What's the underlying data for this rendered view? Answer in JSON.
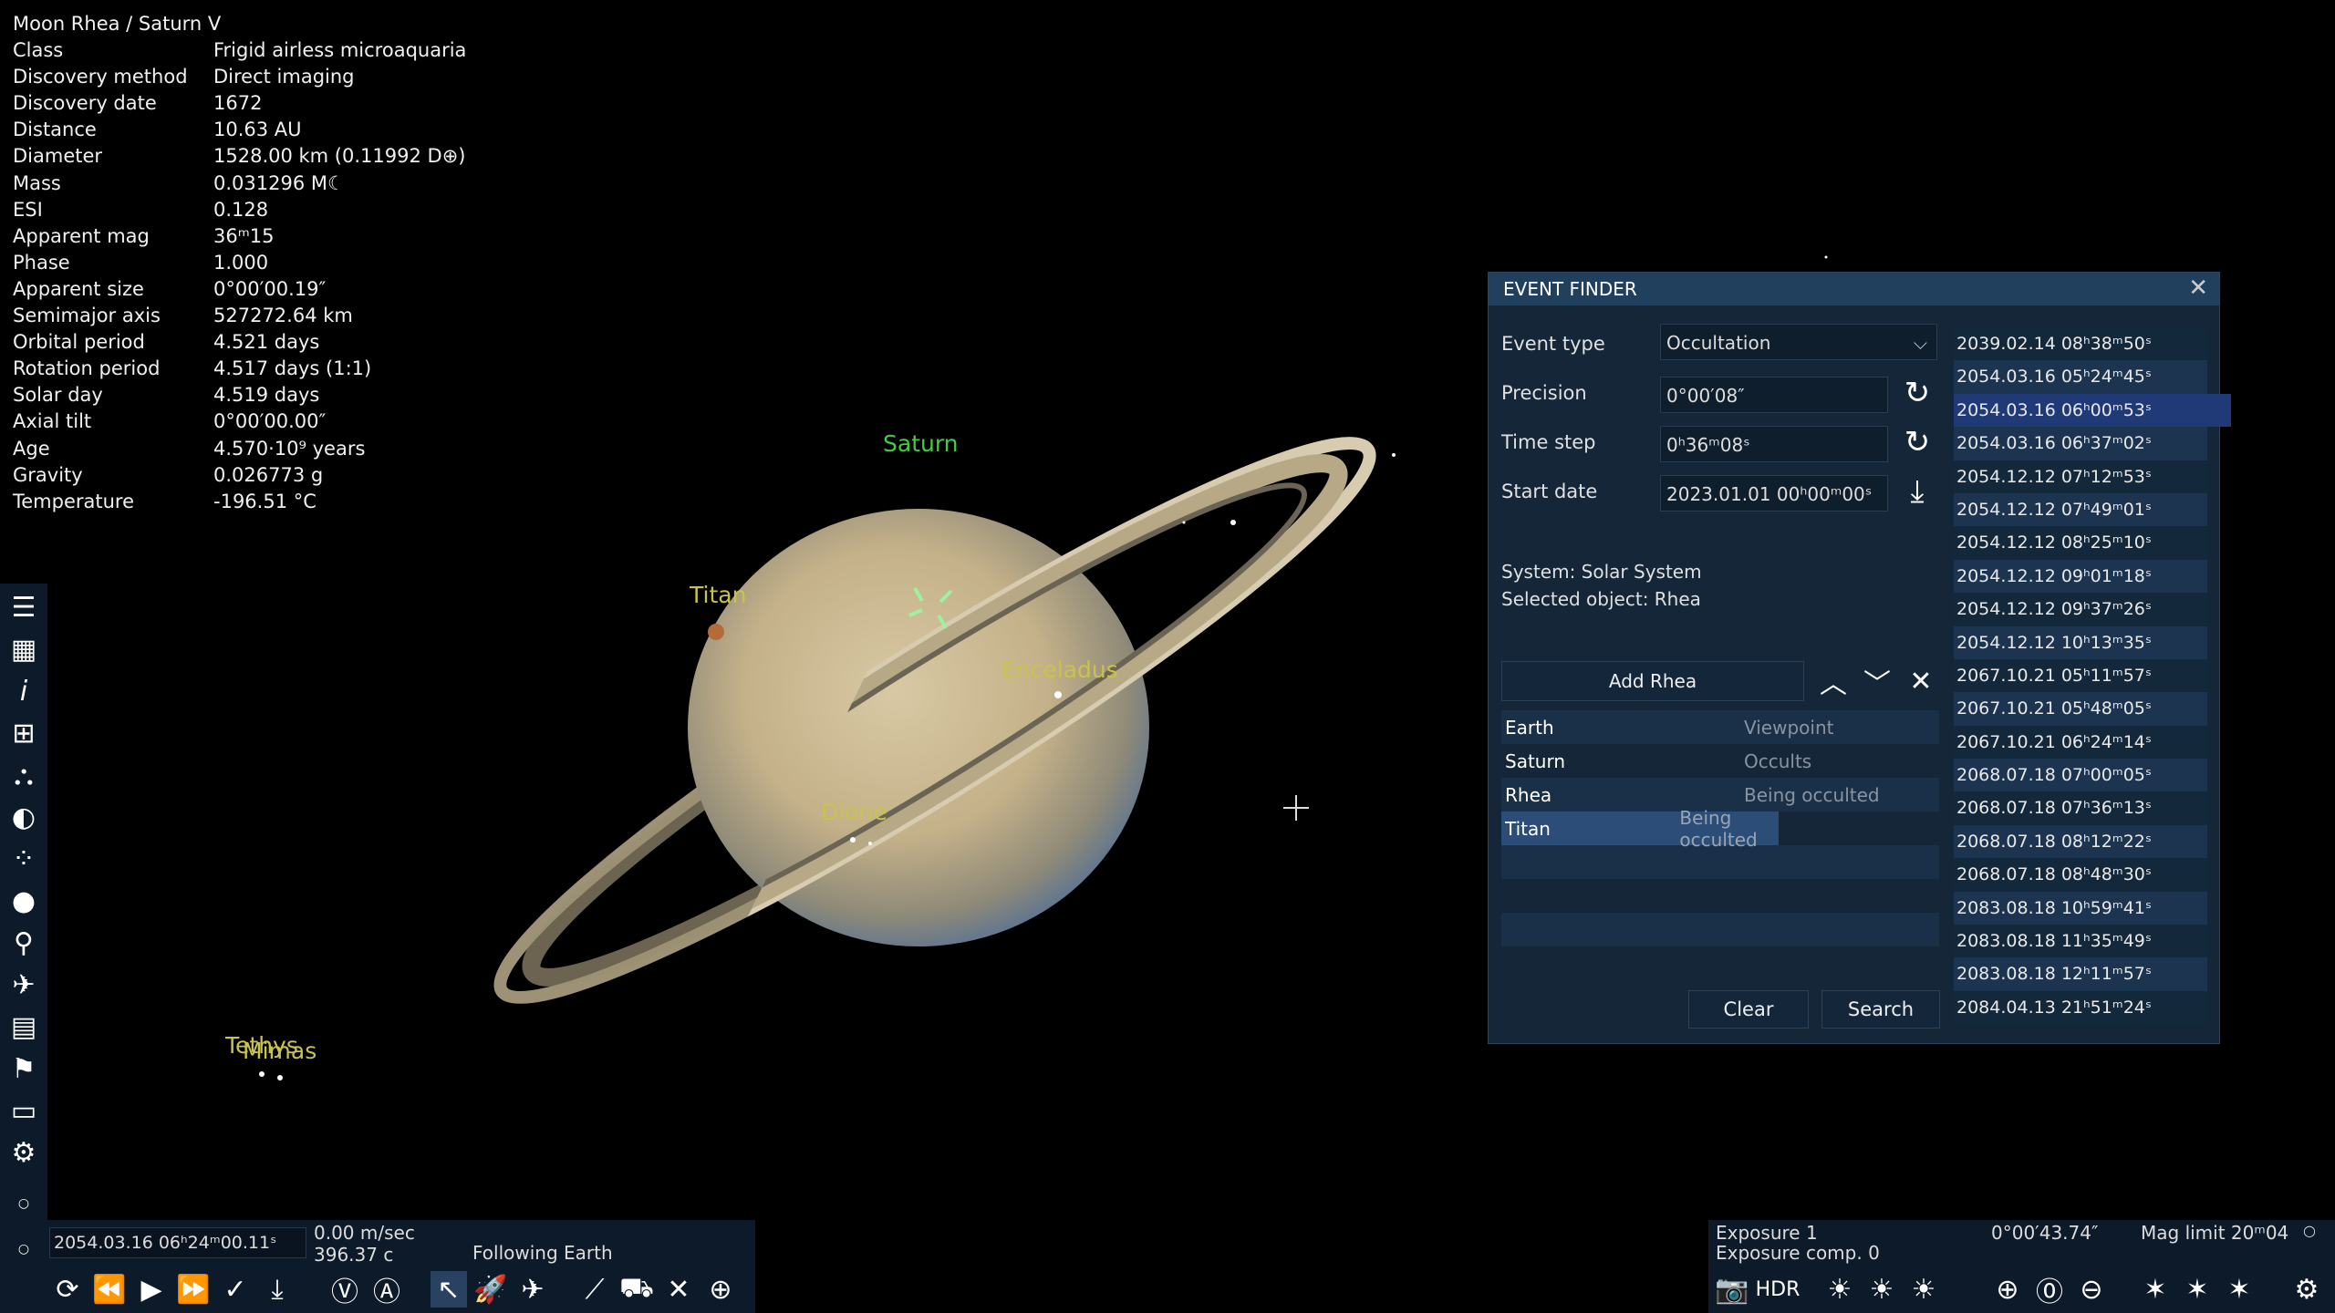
{
  "info": {
    "title": "Moon  Rhea / Saturn V",
    "rows": [
      {
        "k": "Class",
        "v": "Frigid airless microaquaria"
      },
      {
        "k": "Discovery method",
        "v": "Direct imaging"
      },
      {
        "k": "Discovery date",
        "v": "1672"
      },
      {
        "k": "Distance",
        "v": "10.63 AU"
      },
      {
        "k": "Diameter",
        "v": "1528.00 km (0.11992 D⊕)"
      },
      {
        "k": "Mass",
        "v": "0.031296 M☾"
      },
      {
        "k": "ESI",
        "v": "0.128"
      },
      {
        "k": "Apparent mag",
        "v": "36ᵐ15"
      },
      {
        "k": "Phase",
        "v": "1.000"
      },
      {
        "k": "Apparent size",
        "v": "0°00′00.19″"
      },
      {
        "k": "Semimajor axis",
        "v": "527272.64 km"
      },
      {
        "k": "Orbital period",
        "v": "4.521 days"
      },
      {
        "k": "Rotation period",
        "v": "4.517 days (1:1)"
      },
      {
        "k": "Solar day",
        "v": "4.519 days"
      },
      {
        "k": "Axial tilt",
        "v": "0°00′00.00″"
      },
      {
        "k": "Age",
        "v": "4.570·10⁹ years"
      },
      {
        "k": "Gravity",
        "v": "0.026773 g"
      },
      {
        "k": "Temperature",
        "v": "-196.51 °C"
      }
    ]
  },
  "labels": {
    "saturn": "Saturn",
    "titan": "Titan",
    "enceladus": "Enceladus",
    "dione": "Dione",
    "tethys": "Tethys",
    "mimas": "Mimas"
  },
  "colors": {
    "green": "#44cc44",
    "yellow": "#c9c24e",
    "panel": "#142638",
    "header": "#21405e",
    "highlight": "#2c4d78"
  },
  "event_finder": {
    "title": "EVENT FINDER",
    "event_type_label": "Event type",
    "event_type_value": "Occultation",
    "precision_label": "Precision",
    "precision_value": "0°00′08″",
    "time_step_label": "Time step",
    "time_step_value": "0ʰ36ᵐ08ˢ",
    "start_date_label": "Start date",
    "start_date_value": "2023.01.01 00ʰ00ᵐ00ˢ",
    "system": "System: Solar System",
    "selected": "Selected object: Rhea",
    "add_button": "Add Rhea",
    "objects": [
      {
        "name": "Earth",
        "role": "Viewpoint"
      },
      {
        "name": "Saturn",
        "role": "Occults"
      },
      {
        "name": "Rhea",
        "role": "Being occulted"
      },
      {
        "name": "Titan",
        "role": "Being occulted"
      },
      {
        "name": "",
        "role": ""
      },
      {
        "name": "",
        "role": ""
      },
      {
        "name": "",
        "role": ""
      },
      {
        "name": "",
        "role": ""
      }
    ],
    "clear_button": "Clear",
    "search_button": "Search",
    "results": [
      "2039.02.14 08ʰ38ᵐ50ˢ",
      "2054.03.16 05ʰ24ᵐ45ˢ",
      "2054.03.16 06ʰ00ᵐ53ˢ",
      "2054.03.16 06ʰ37ᵐ02ˢ",
      "2054.12.12 07ʰ12ᵐ53ˢ",
      "2054.12.12 07ʰ49ᵐ01ˢ",
      "2054.12.12 08ʰ25ᵐ10ˢ",
      "2054.12.12 09ʰ01ᵐ18ˢ",
      "2054.12.12 09ʰ37ᵐ26ˢ",
      "2054.12.12 10ʰ13ᵐ35ˢ",
      "2067.10.21 05ʰ11ᵐ57ˢ",
      "2067.10.21 05ʰ48ᵐ05ˢ",
      "2067.10.21 06ʰ24ᵐ14ˢ",
      "2068.07.18 07ʰ00ᵐ05ˢ",
      "2068.07.18 07ʰ36ᵐ13ˢ",
      "2068.07.18 08ʰ12ᵐ22ˢ",
      "2068.07.18 08ʰ48ᵐ30ˢ",
      "2083.08.18 10ʰ59ᵐ41ˢ",
      "2083.08.18 11ʰ35ᵐ49ˢ",
      "2083.08.18 12ʰ11ᵐ57ˢ",
      "2084.04.13 21ʰ51ᵐ24ˢ"
    ]
  },
  "bottom_left": {
    "time": "2054.03.16 06ʰ24ᵐ00.11ˢ",
    "speed1": "0.00 m/sec",
    "speed2": "396.37 c",
    "following": "Following Earth"
  },
  "bottom_right": {
    "exposure": "Exposure 1",
    "exposure_comp": "Exposure comp. 0",
    "fov": "0°00′43.74″",
    "mag_limit": "Mag limit 20ᵐ04",
    "hdr": "HDR"
  }
}
